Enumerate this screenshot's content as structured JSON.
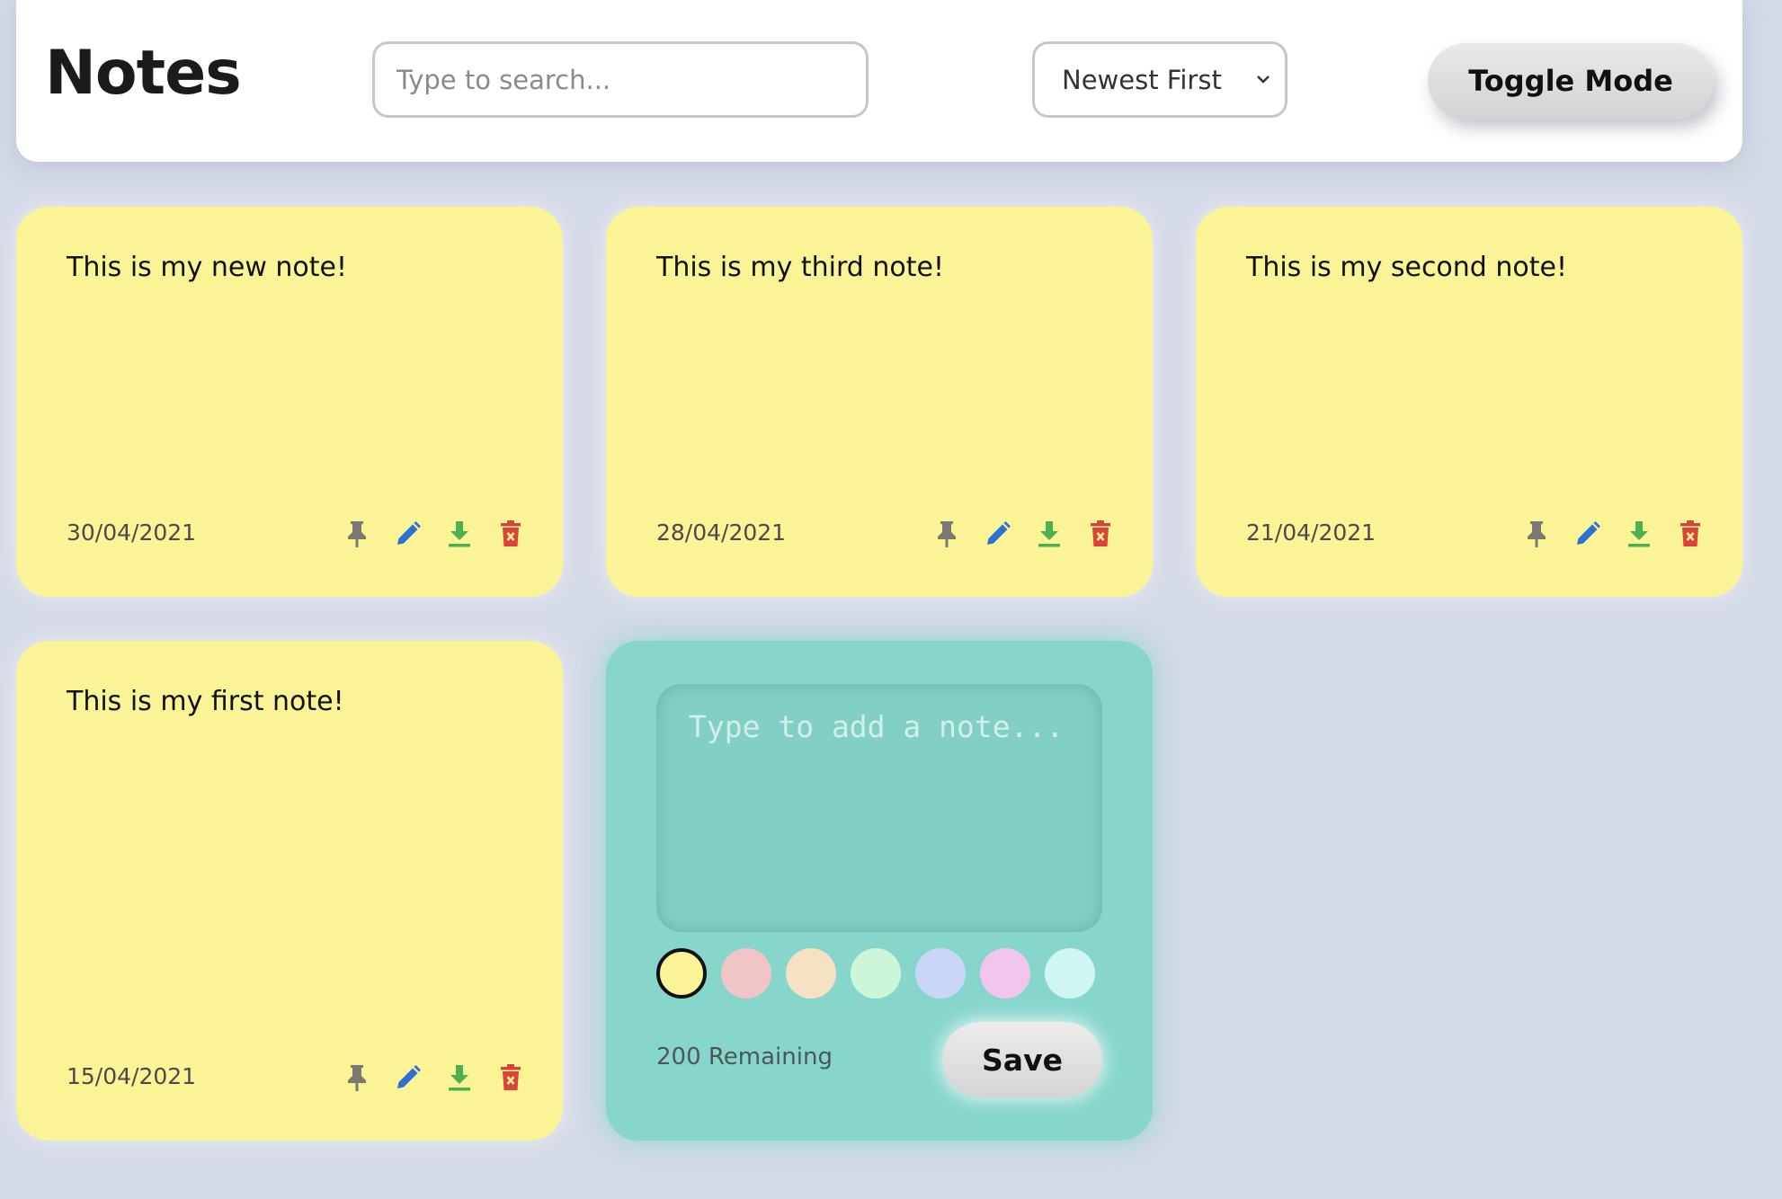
{
  "header": {
    "title": "Notes",
    "search_placeholder": "Type to search...",
    "sort_value": "Newest First",
    "toggle_label": "Toggle Mode"
  },
  "notes": [
    {
      "text": "This is my new note!",
      "date": "30/04/2021",
      "color": "#fbf497"
    },
    {
      "text": "This is my third note!",
      "date": "28/04/2021",
      "color": "#fbf497"
    },
    {
      "text": "This is my second note!",
      "date": "21/04/2021",
      "color": "#fbf497"
    },
    {
      "text": "This is my first note!",
      "date": "15/04/2021",
      "color": "#fbf497"
    }
  ],
  "note_actions": [
    "pin-icon",
    "edit-icon",
    "download-icon",
    "delete-icon"
  ],
  "action_colors": {
    "pin": "#7a7a72",
    "edit": "#2f6fd6",
    "download": "#4caf50",
    "delete": "#d9443a"
  },
  "new_note": {
    "placeholder": "Type to add a note...",
    "card_color": "#86d6cb",
    "swatches": [
      "#fbf497",
      "#f1c4c8",
      "#f6e1c3",
      "#cdf6d9",
      "#cad6f6",
      "#f2c6ec",
      "#cff6f1"
    ],
    "selected_swatch": 0,
    "remaining": "200 Remaining",
    "save_label": "Save"
  }
}
